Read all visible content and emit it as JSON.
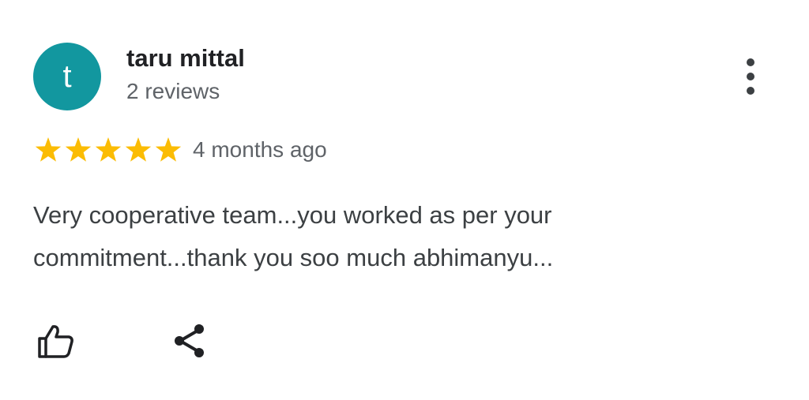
{
  "review": {
    "author": {
      "initial": "t",
      "name": "taru mittal",
      "reviews_count": "2 reviews",
      "avatar_color": "#12979f"
    },
    "rating": {
      "stars": 5,
      "max_stars": 5,
      "star_color": "#fbbc04"
    },
    "time": "4 months ago",
    "text_lines": [
      "Very cooperative team...you worked as per your",
      "commitment...thank you soo much abhimanyu..."
    ]
  },
  "icons": {
    "more": "more-vert-icon",
    "like": "thumb-up-icon",
    "share": "share-icon"
  }
}
